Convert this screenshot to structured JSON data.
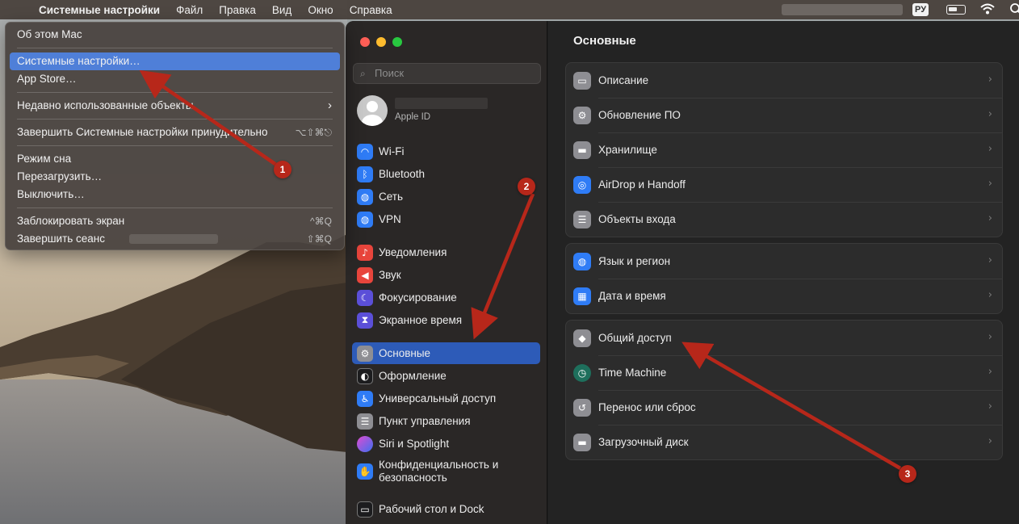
{
  "menubar": {
    "app": "Системные настройки",
    "items": [
      "Файл",
      "Правка",
      "Вид",
      "Окно",
      "Справка"
    ],
    "lang": "РУ"
  },
  "apple_menu": {
    "about": "Об этом Mac",
    "settings": "Системные настройки…",
    "appstore": "App Store…",
    "recent": "Недавно использованные объекты",
    "force_quit": "Завершить Системные настройки принудительно",
    "force_quit_sc": "⌥⇧⌘⎋",
    "sleep": "Режим сна",
    "restart": "Перезагрузить…",
    "shutdown": "Выключить…",
    "lock": "Заблокировать экран",
    "lock_sc": "^⌘Q",
    "logout": "Завершить сеанс",
    "logout_sc": "⇧⌘Q"
  },
  "sidebar": {
    "search_placeholder": "Поиск",
    "apple_id": "Apple ID",
    "items": [
      {
        "label": "Wi‑Fi",
        "icon": "wifi-icon",
        "color": "#2f7cf6"
      },
      {
        "label": "Bluetooth",
        "icon": "bluetooth-icon",
        "color": "#2f7cf6"
      },
      {
        "label": "Сеть",
        "icon": "network-icon",
        "color": "#2f7cf6"
      },
      {
        "label": "VPN",
        "icon": "vpn-icon",
        "color": "#2f7cf6"
      },
      {
        "label": "Уведомления",
        "icon": "notifications-icon",
        "color": "#e8453c"
      },
      {
        "label": "Звук",
        "icon": "sound-icon",
        "color": "#e8453c"
      },
      {
        "label": "Фокусирование",
        "icon": "focus-icon",
        "color": "#5b4fd8"
      },
      {
        "label": "Экранное время",
        "icon": "screen-time-icon",
        "color": "#5b4fd8"
      },
      {
        "label": "Основные",
        "icon": "general-icon",
        "color": "#8e8e93"
      },
      {
        "label": "Оформление",
        "icon": "appearance-icon",
        "color": "#1c1c1e"
      },
      {
        "label": "Универсальный доступ",
        "icon": "accessibility-icon",
        "color": "#2f7cf6"
      },
      {
        "label": "Пункт управления",
        "icon": "control-center-icon",
        "color": "#8e8e93"
      },
      {
        "label": "Siri и Spotlight",
        "icon": "siri-icon",
        "color": "#7a3fd1"
      },
      {
        "label": "Конфиденциальность и безопасность",
        "icon": "privacy-hand-icon",
        "color": "#2f7cf6"
      },
      {
        "label": "Рабочий стол и Dock",
        "icon": "desktop-dock-icon",
        "color": "#1c1c1e"
      }
    ]
  },
  "content": {
    "title": "Основные",
    "groups": [
      [
        {
          "label": "Описание",
          "icon": "laptop-icon"
        },
        {
          "label": "Обновление ПО",
          "icon": "gear-badge-icon"
        },
        {
          "label": "Хранилище",
          "icon": "storage-drive-icon"
        },
        {
          "label": "AirDrop и Handoff",
          "icon": "airdrop-icon"
        },
        {
          "label": "Объекты входа",
          "icon": "list-icon"
        }
      ],
      [
        {
          "label": "Язык и регион",
          "icon": "globe-icon"
        },
        {
          "label": "Дата и время",
          "icon": "calendar-icon"
        }
      ],
      [
        {
          "label": "Общий доступ",
          "icon": "sharing-icon"
        },
        {
          "label": "Time Machine",
          "icon": "time-machine-icon"
        },
        {
          "label": "Перенос или сброс",
          "icon": "reset-icon"
        },
        {
          "label": "Загрузочный диск",
          "icon": "startup-disk-icon"
        }
      ]
    ]
  },
  "annotations": {
    "one": "1",
    "two": "2",
    "three": "3"
  },
  "colors": {
    "accent": "#2d5bb8",
    "arrow": "#b7271a",
    "menu_selection": "#4f7fd8"
  }
}
